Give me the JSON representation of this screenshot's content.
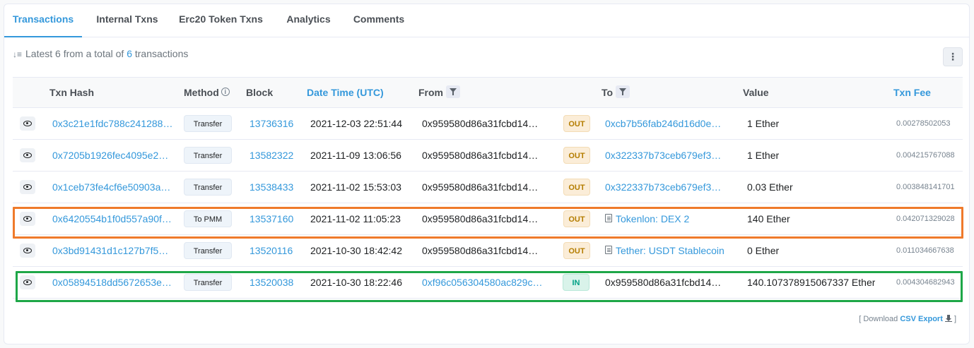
{
  "tabs": [
    {
      "label": "Transactions"
    },
    {
      "label": "Internal Txns"
    },
    {
      "label": "Erc20 Token Txns"
    },
    {
      "label": "Analytics"
    },
    {
      "label": "Comments"
    }
  ],
  "summary": {
    "prefix": "Latest 6 from a total of",
    "count": "6",
    "suffix": "transactions"
  },
  "more_button": "⋮",
  "columns": {
    "txn_hash": "Txn Hash",
    "method": "Method",
    "block": "Block",
    "date_time": "Date Time (UTC)",
    "from": "From",
    "to": "To",
    "value": "Value",
    "txn_fee": "Txn Fee"
  },
  "rows": [
    {
      "hash": "0x3c21e1fdc788c241288…",
      "method": "Transfer",
      "block": "13736316",
      "time": "2021-12-03 22:51:44",
      "from": "0x959580d86a31fcbd14…",
      "dir": "OUT",
      "to": "0xcb7b56fab246d16d0e…",
      "value": "1 Ether",
      "fee": "0.00278502053"
    },
    {
      "hash": "0x7205b1926fec4095e2…",
      "method": "Transfer",
      "block": "13582322",
      "time": "2021-11-09 13:06:56",
      "from": "0x959580d86a31fcbd14…",
      "dir": "OUT",
      "to": "0x322337b73ceb679ef3…",
      "value": "1 Ether",
      "fee": "0.004215767088"
    },
    {
      "hash": "0x1ceb73fe4cf6e50903a…",
      "method": "Transfer",
      "block": "13538433",
      "time": "2021-11-02 15:53:03",
      "from": "0x959580d86a31fcbd14…",
      "dir": "OUT",
      "to": "0x322337b73ceb679ef3…",
      "value": "0.03 Ether",
      "fee": "0.003848141701"
    },
    {
      "hash": "0x6420554b1f0d557a90f…",
      "method": "To PMM",
      "block": "13537160",
      "time": "2021-11-02 11:05:23",
      "from": "0x959580d86a31fcbd14…",
      "dir": "OUT",
      "to": "Tokenlon: DEX 2",
      "value": "140 Ether",
      "fee": "0.042071329028"
    },
    {
      "hash": "0x3bd91431d1c127b7f5…",
      "method": "Transfer",
      "block": "13520116",
      "time": "2021-10-30 18:42:42",
      "from": "0x959580d86a31fcbd14…",
      "dir": "OUT",
      "to": "Tether: USDT Stablecoin",
      "value": "0 Ether",
      "fee": "0.011034667638"
    },
    {
      "hash": "0x05894518dd5672653e…",
      "method": "Transfer",
      "block": "13520038",
      "time": "2021-10-30 18:22:46",
      "from": "0xf96c056304580ac829c…",
      "dir": "IN",
      "to": "0x959580d86a31fcbd14…",
      "value": "140.107378915067337 Ether",
      "fee": "0.004304682943"
    }
  ],
  "footer": {
    "prefix": "[ Download",
    "csv": "CSV Export",
    "suffix": "]"
  },
  "colors": {
    "accent": "#3498db",
    "highlight_orange": "#ef7a2b",
    "highlight_green": "#1ea748"
  }
}
